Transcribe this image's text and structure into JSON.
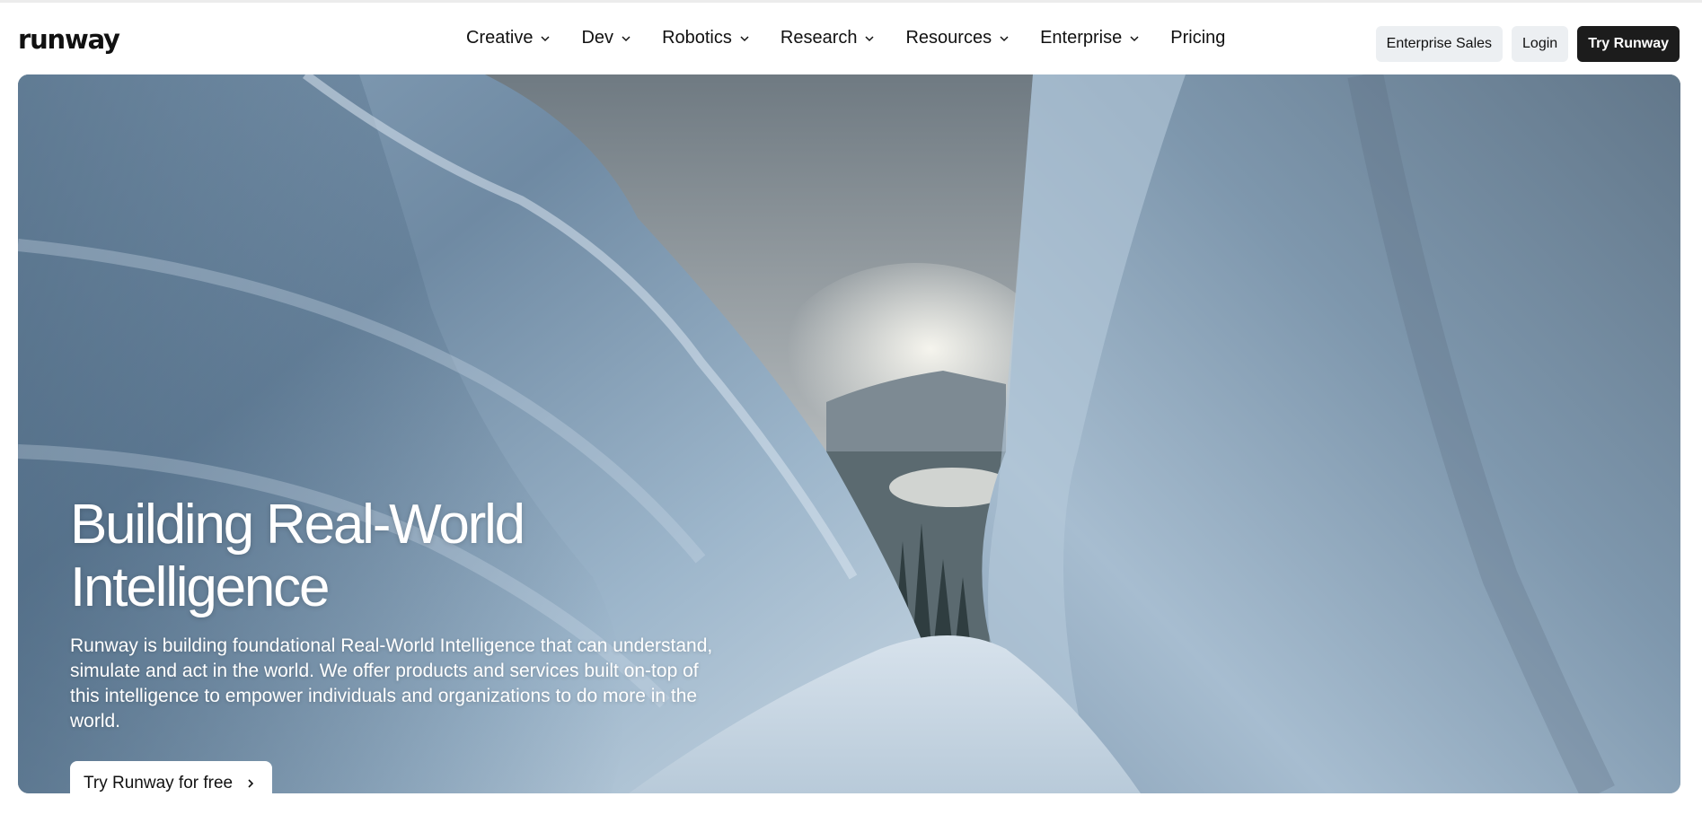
{
  "brand": {
    "logo": "runway"
  },
  "nav": {
    "items": [
      {
        "label": "Creative",
        "has_dropdown": true
      },
      {
        "label": "Dev",
        "has_dropdown": true
      },
      {
        "label": "Robotics",
        "has_dropdown": true
      },
      {
        "label": "Research",
        "has_dropdown": true
      },
      {
        "label": "Resources",
        "has_dropdown": true
      },
      {
        "label": "Enterprise",
        "has_dropdown": true
      },
      {
        "label": "Pricing",
        "has_dropdown": false
      }
    ]
  },
  "actions": {
    "enterprise_sales": "Enterprise Sales",
    "login": "Login",
    "try_runway": "Try Runway"
  },
  "hero": {
    "title": "Building Real-World Intelligence",
    "description": "Runway is building foundational Real-World Intelligence that can understand, simulate and act in the world. We offer products and services built on-top of this intelligence to empower individuals and organizations to do more in the world.",
    "cta_label": "Try Runway for free",
    "cta_icon": "chevron-right-icon"
  },
  "colors": {
    "accent_dark": "#1c1c1c",
    "button_light": "#eceff2",
    "ice": "#9fb6cb"
  }
}
